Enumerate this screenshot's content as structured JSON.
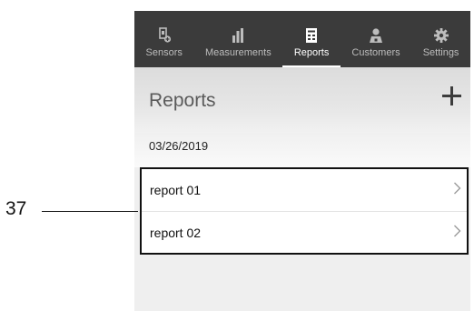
{
  "tabs": [
    {
      "label": "Sensors",
      "icon": "sensor-icon",
      "active": false
    },
    {
      "label": "Measurements",
      "icon": "bar-chart-icon",
      "active": false
    },
    {
      "label": "Reports",
      "icon": "report-icon",
      "active": true
    },
    {
      "label": "Customers",
      "icon": "customer-icon",
      "active": false
    },
    {
      "label": "Settings",
      "icon": "gear-icon",
      "active": false
    }
  ],
  "header": {
    "title": "Reports",
    "add_icon": "plus-icon"
  },
  "date_group": "03/26/2019",
  "reports": [
    {
      "name": "report 01"
    },
    {
      "name": "report 02"
    }
  ],
  "callout": {
    "number": "37"
  },
  "colors": {
    "tabbar": "#3b3b3b",
    "background": "#efefef"
  }
}
